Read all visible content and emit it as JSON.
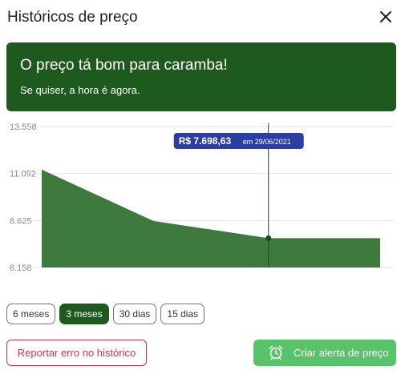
{
  "header": {
    "title": "Históricos de preço",
    "close_icon": "close-icon"
  },
  "banner": {
    "title": "O preço tá bom para caramba!",
    "subtitle": "Se quiser, a hora é agora.",
    "color": "#1e5a1e"
  },
  "tooltip": {
    "price": "R$ 7.698,63",
    "date": "em 29/06/2021",
    "color": "#2a3ea3"
  },
  "colors": {
    "area": "#3e7a3e",
    "primary": "#1e5a1e",
    "alert": "#58c36b",
    "danger": "#c0394b"
  },
  "chart_data": {
    "type": "area",
    "y_ticks": [
      "13.558",
      "11.092",
      "8.625",
      "6.158"
    ],
    "y_tick_values": [
      13558,
      11092,
      8625,
      6158
    ],
    "ylim": [
      6158,
      13558
    ],
    "values": [
      11300,
      8600,
      7698.63,
      7698.63
    ],
    "x_positions": [
      0,
      0.33,
      0.67,
      1.0
    ],
    "highlight_index": 2,
    "xlabel": "",
    "ylabel": ""
  },
  "ranges": [
    {
      "label": "6 meses",
      "active": false
    },
    {
      "label": "3 meses",
      "active": true
    },
    {
      "label": "30 dias",
      "active": false
    },
    {
      "label": "15 dias",
      "active": false
    }
  ],
  "actions": {
    "report_label": "Reportar erro no histórico",
    "alert_label": "Criar alerta de preço",
    "alert_icon": "alarm-clock-icon"
  }
}
